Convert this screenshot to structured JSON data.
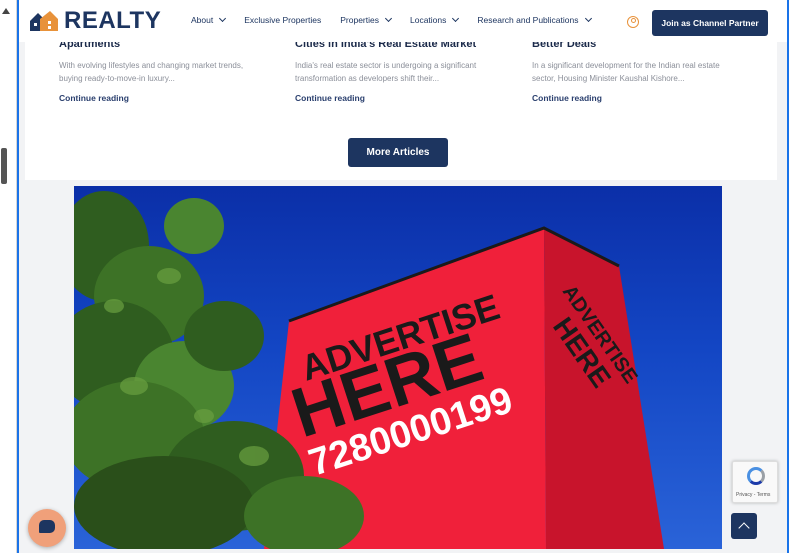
{
  "header": {
    "logo": "REALTY",
    "nav": [
      {
        "label": "About",
        "has_dropdown": true
      },
      {
        "label": "Exclusive Properties",
        "has_dropdown": false
      },
      {
        "label": "Properties",
        "has_dropdown": true
      },
      {
        "label": "Locations",
        "has_dropdown": true
      },
      {
        "label": "Research and Publications",
        "has_dropdown": true
      }
    ],
    "user_icon": "user-circle-icon",
    "partner_button": "Join as Channel Partner"
  },
  "articles": [
    {
      "title": "Apartments",
      "excerpt": "With evolving lifestyles and changing market trends, buying ready-to-move-in luxury...",
      "link": "Continue reading"
    },
    {
      "title": "Cities in India's Real Estate Market",
      "excerpt": "India's real estate sector is undergoing a significant transformation as developers shift their...",
      "link": "Continue reading"
    },
    {
      "title": "Better Deals",
      "excerpt": "In a significant development for the Indian real estate sector, Housing Minister Kaushal Kishore...",
      "link": "Continue reading"
    }
  ],
  "more_button": "More Articles",
  "advertisement": {
    "line1": "ADVERTISE",
    "line2": "HERE",
    "phone": "7280000199",
    "side_line1": "ADVERTISE",
    "side_line2": "HERE"
  },
  "recaptcha": {
    "text": "Privacy - Terms"
  },
  "colors": {
    "navy": "#1d3560",
    "accent": "#e8923a",
    "billboard": "#f0203a"
  }
}
